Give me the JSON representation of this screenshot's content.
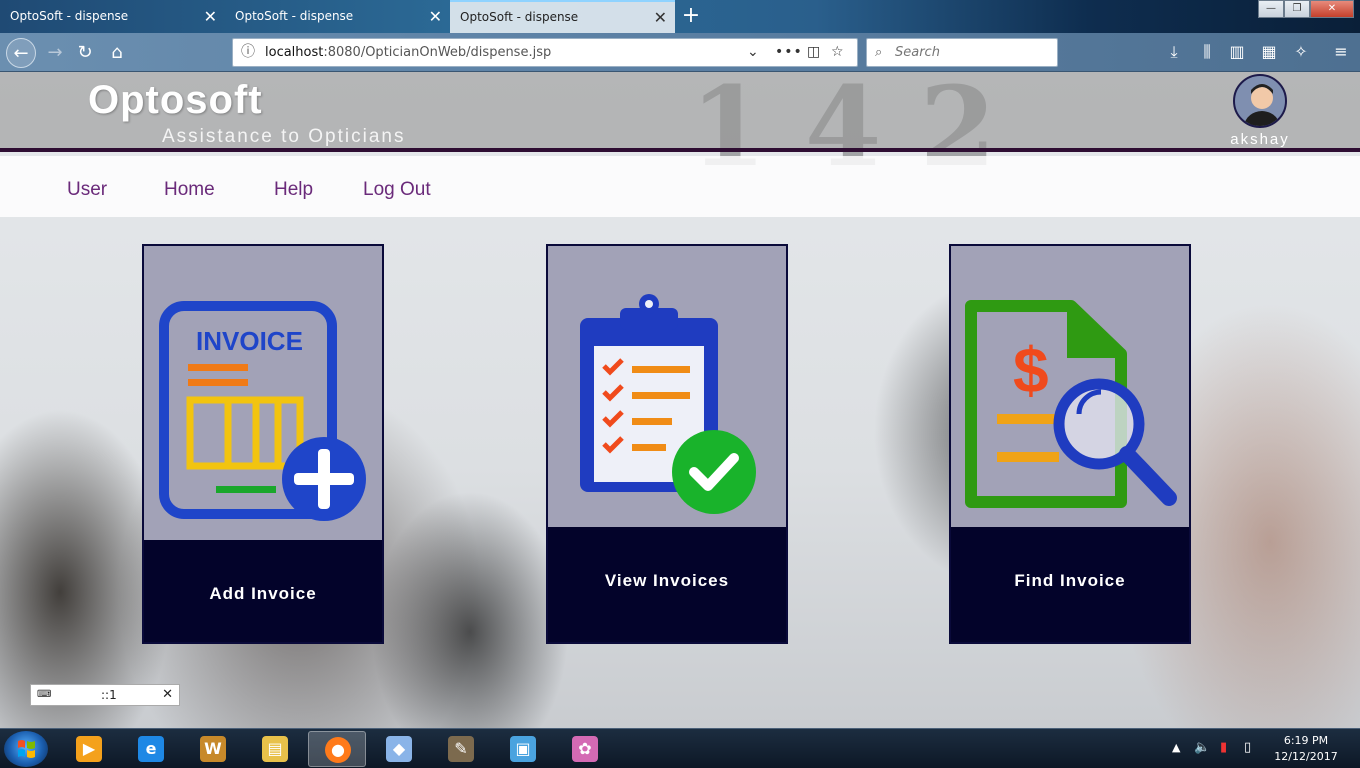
{
  "browser": {
    "tabs": [
      {
        "title": "OptoSoft - dispense",
        "active": false
      },
      {
        "title": "OptoSoft - dispense",
        "active": false
      },
      {
        "title": "OptoSoft - dispense",
        "active": true
      }
    ],
    "new_tab_label": "+",
    "url_host": "localhost",
    "url_path": ":8080/OpticianOnWeb/dispense.jsp",
    "search_placeholder": "Search",
    "window_controls": {
      "minimize": "—",
      "restore": "❐",
      "close": "✕"
    }
  },
  "site": {
    "title": "Optosoft",
    "subtitle": "Assistance to Opticians",
    "user_name": "akshay"
  },
  "menu": {
    "items": [
      {
        "label": "User"
      },
      {
        "label": "Home"
      },
      {
        "label": "Help"
      },
      {
        "label": "Log Out"
      }
    ]
  },
  "cards": [
    {
      "label": "Add Invoice",
      "image_text": "INVOICE",
      "icon": "invoice-add-icon"
    },
    {
      "label": "View Invoices",
      "icon": "clipboard-check-icon"
    },
    {
      "label": "Find Invoice",
      "icon": "invoice-search-icon"
    }
  ],
  "ime": {
    "text": "::1"
  },
  "taskbar": {
    "apps": [
      {
        "name": "media-player",
        "color": "#f4a11c"
      },
      {
        "name": "internet-explorer",
        "color": "#1e88e5"
      },
      {
        "name": "word",
        "color": "#c7892a"
      },
      {
        "name": "file-explorer",
        "color": "#e8c14a"
      },
      {
        "name": "firefox",
        "color": "#ff7a1a",
        "active": true
      },
      {
        "name": "virtualbox",
        "color": "#8ab4e8"
      },
      {
        "name": "gimp",
        "color": "#7c6a4e"
      },
      {
        "name": "image-viewer",
        "color": "#4aa3df"
      },
      {
        "name": "paint",
        "color": "#d46ab4"
      }
    ],
    "clock_time": "6:19 PM",
    "clock_date": "12/12/2017"
  },
  "colors": {
    "menu_text": "#6a2a7a",
    "card_bg": "#03032a",
    "header_border": "#2e0d32"
  }
}
